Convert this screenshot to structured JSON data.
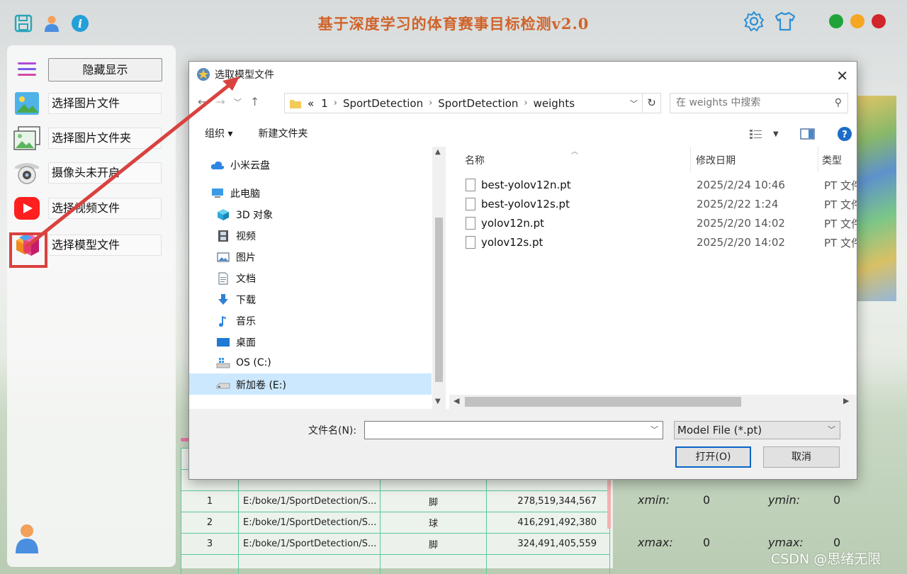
{
  "app": {
    "title": "基于深度学习的体育赛事目标检测v2.0",
    "colors": {
      "title": "#d0632a",
      "green": "#1fa33a",
      "orange": "#f5a623",
      "red": "#d0252b",
      "highlight": "#d9423f"
    }
  },
  "left_panel": {
    "toggle_label": "隐藏显示",
    "items": [
      {
        "label": "选择图片文件",
        "icon": "image-icon"
      },
      {
        "label": "选择图片文件夹",
        "icon": "folder-images-icon"
      },
      {
        "label": "摄像头未开启",
        "icon": "camera-icon"
      },
      {
        "label": "选择视频文件",
        "icon": "video-icon"
      },
      {
        "label": "选择模型文件",
        "icon": "model-cube-icon"
      }
    ]
  },
  "dialog": {
    "title": "选取模型文件",
    "breadcrumb": [
      "«",
      "1",
      "SportDetection",
      "SportDetection",
      "weights"
    ],
    "search_placeholder": "在 weights 中搜索",
    "toolbar": {
      "organize": "组织 ▾",
      "new_folder": "新建文件夹"
    },
    "nav": [
      {
        "label": "小米云盘",
        "icon": "cloud-icon"
      },
      {
        "label": "此电脑",
        "icon": "computer-icon"
      },
      {
        "label": "3D 对象",
        "icon": "cube-3d-icon"
      },
      {
        "label": "视频",
        "icon": "film-icon"
      },
      {
        "label": "图片",
        "icon": "picture-icon"
      },
      {
        "label": "文档",
        "icon": "document-icon"
      },
      {
        "label": "下载",
        "icon": "download-icon"
      },
      {
        "label": "音乐",
        "icon": "music-icon"
      },
      {
        "label": "桌面",
        "icon": "desktop-icon"
      },
      {
        "label": "OS (C:)",
        "icon": "drive-c-icon"
      },
      {
        "label": "新加卷 (E:)",
        "icon": "drive-icon"
      }
    ],
    "columns": {
      "name": "名称",
      "date": "修改日期",
      "type": "类型"
    },
    "files": [
      {
        "name": "best-yolov12n.pt",
        "date": "2025/2/24 10:46",
        "type": "PT 文件"
      },
      {
        "name": "best-yolov12s.pt",
        "date": "2025/2/22 1:24",
        "type": "PT 文件"
      },
      {
        "name": "yolov12n.pt",
        "date": "2025/2/20 14:02",
        "type": "PT 文件"
      },
      {
        "name": "yolov12s.pt",
        "date": "2025/2/20 14:02",
        "type": "PT 文件"
      }
    ],
    "filename_label": "文件名(N):",
    "filename_value": "",
    "filetype": "Model File (*.pt)",
    "open_label": "打开(O)",
    "cancel_label": "取消"
  },
  "results_table": {
    "rows": [
      {
        "idx": "1",
        "path": "E:/boke/1/SportDetection/S...",
        "cls": "脚",
        "box": "278,519,344,567"
      },
      {
        "idx": "2",
        "path": "E:/boke/1/SportDetection/S...",
        "cls": "球",
        "box": "416,291,492,380"
      },
      {
        "idx": "3",
        "path": "E:/boke/1/SportDetection/S...",
        "cls": "脚",
        "box": "324,491,405,559"
      }
    ]
  },
  "coords": {
    "xmin_label": "xmin:",
    "xmin": "0",
    "ymin_label": "ymin:",
    "ymin": "0",
    "xmax_label": "xmax:",
    "xmax": "0",
    "ymax_label": "ymax:",
    "ymax": "0"
  },
  "watermark": "CSDN @思绪无限"
}
